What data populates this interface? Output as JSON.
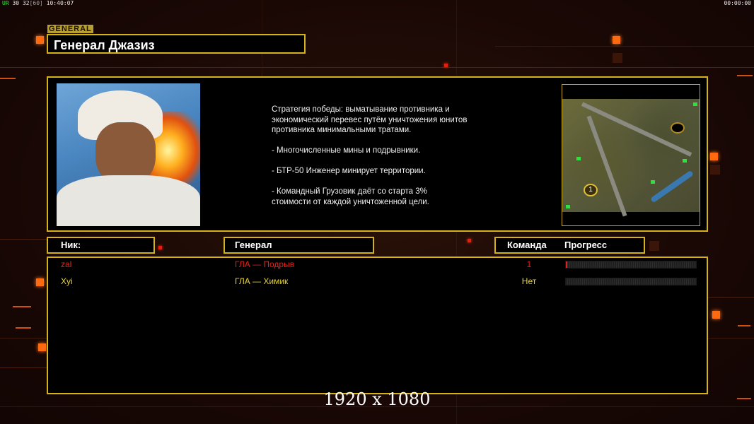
{
  "hud": {
    "fps_prefix": "UR",
    "fps": "30",
    "fps2": "32",
    "fps_target": "[60]",
    "clock": "10:40:07",
    "timer": "00:00:00"
  },
  "header": {
    "tag": "GENERAL",
    "general_name": "Генерал Джазиз"
  },
  "description": {
    "paragraphs": [
      "Стратегия победы: выматывание противника и\n экономический перевес путём уничтожения юнитов\n противника минимальными тратами.",
      "- Многочисленные мины и подрывники.",
      "- БТР-50 Инженер минирует территории.",
      "- Командный Грузовик даёт со старта 3%\n стоимости от каждой уничтоженной цели."
    ]
  },
  "minimap": {
    "start_position": "1"
  },
  "table": {
    "col_nick": "Ник:",
    "col_general": "Генерал",
    "col_team": "Команда",
    "col_progress": "Прогресс",
    "rows": [
      {
        "nick": "zal",
        "general": "ГЛА — Подрыв",
        "team": "1",
        "progress": 0.01,
        "color": "#e8201c"
      },
      {
        "nick": "Xyi",
        "general": "ГЛА — Химик",
        "team": "Нет",
        "progress": 0.0,
        "color": "#e6d43a"
      }
    ]
  },
  "colors": {
    "frame": "#d6b21a",
    "accent": "#ff6a10"
  },
  "resolution_label": "1920 x 1080"
}
